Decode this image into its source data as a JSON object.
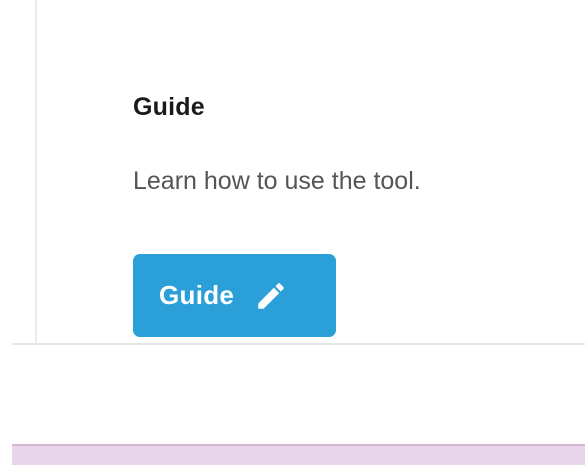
{
  "card": {
    "title": "Guide",
    "description": "Learn how to use the tool.",
    "button": {
      "label": "Guide",
      "icon": "pencil-icon"
    }
  },
  "colors": {
    "button_bg": "#2a9fd8",
    "button_text": "#ffffff",
    "footer_strip": "#e9d5ea"
  }
}
